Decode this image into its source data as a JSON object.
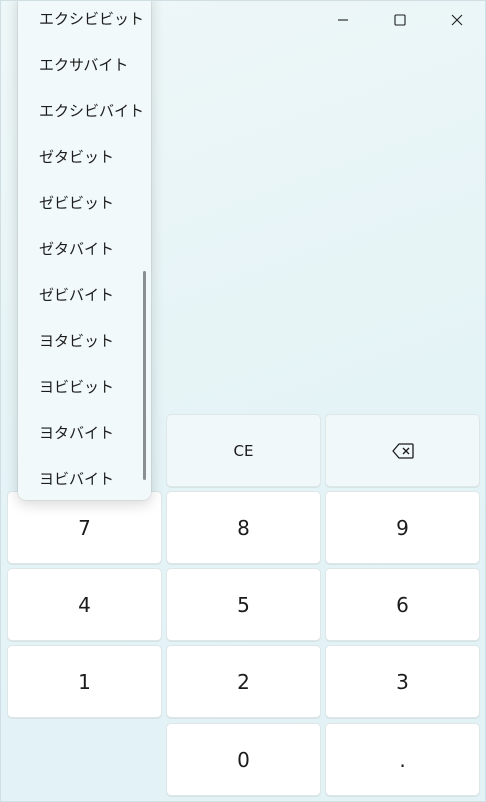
{
  "titlebar": {
    "minimize_icon": "minimize-icon",
    "maximize_icon": "maximize-icon",
    "close_icon": "close-icon"
  },
  "unit_dropdown": {
    "items": [
      "エクシビビット",
      "エクサバイト",
      "エクシビバイト",
      "ゼタビット",
      "ゼビビット",
      "ゼタバイト",
      "ゼビバイト",
      "ヨタビット",
      "ヨビビット",
      "ヨタバイト",
      "ヨビバイト"
    ]
  },
  "keypad": {
    "ce": "CE",
    "backspace_icon": "backspace-icon",
    "k7": "7",
    "k8": "8",
    "k9": "9",
    "k4": "4",
    "k5": "5",
    "k6": "6",
    "k1": "1",
    "k2": "2",
    "k3": "3",
    "k0": "0",
    "decimal": "."
  }
}
